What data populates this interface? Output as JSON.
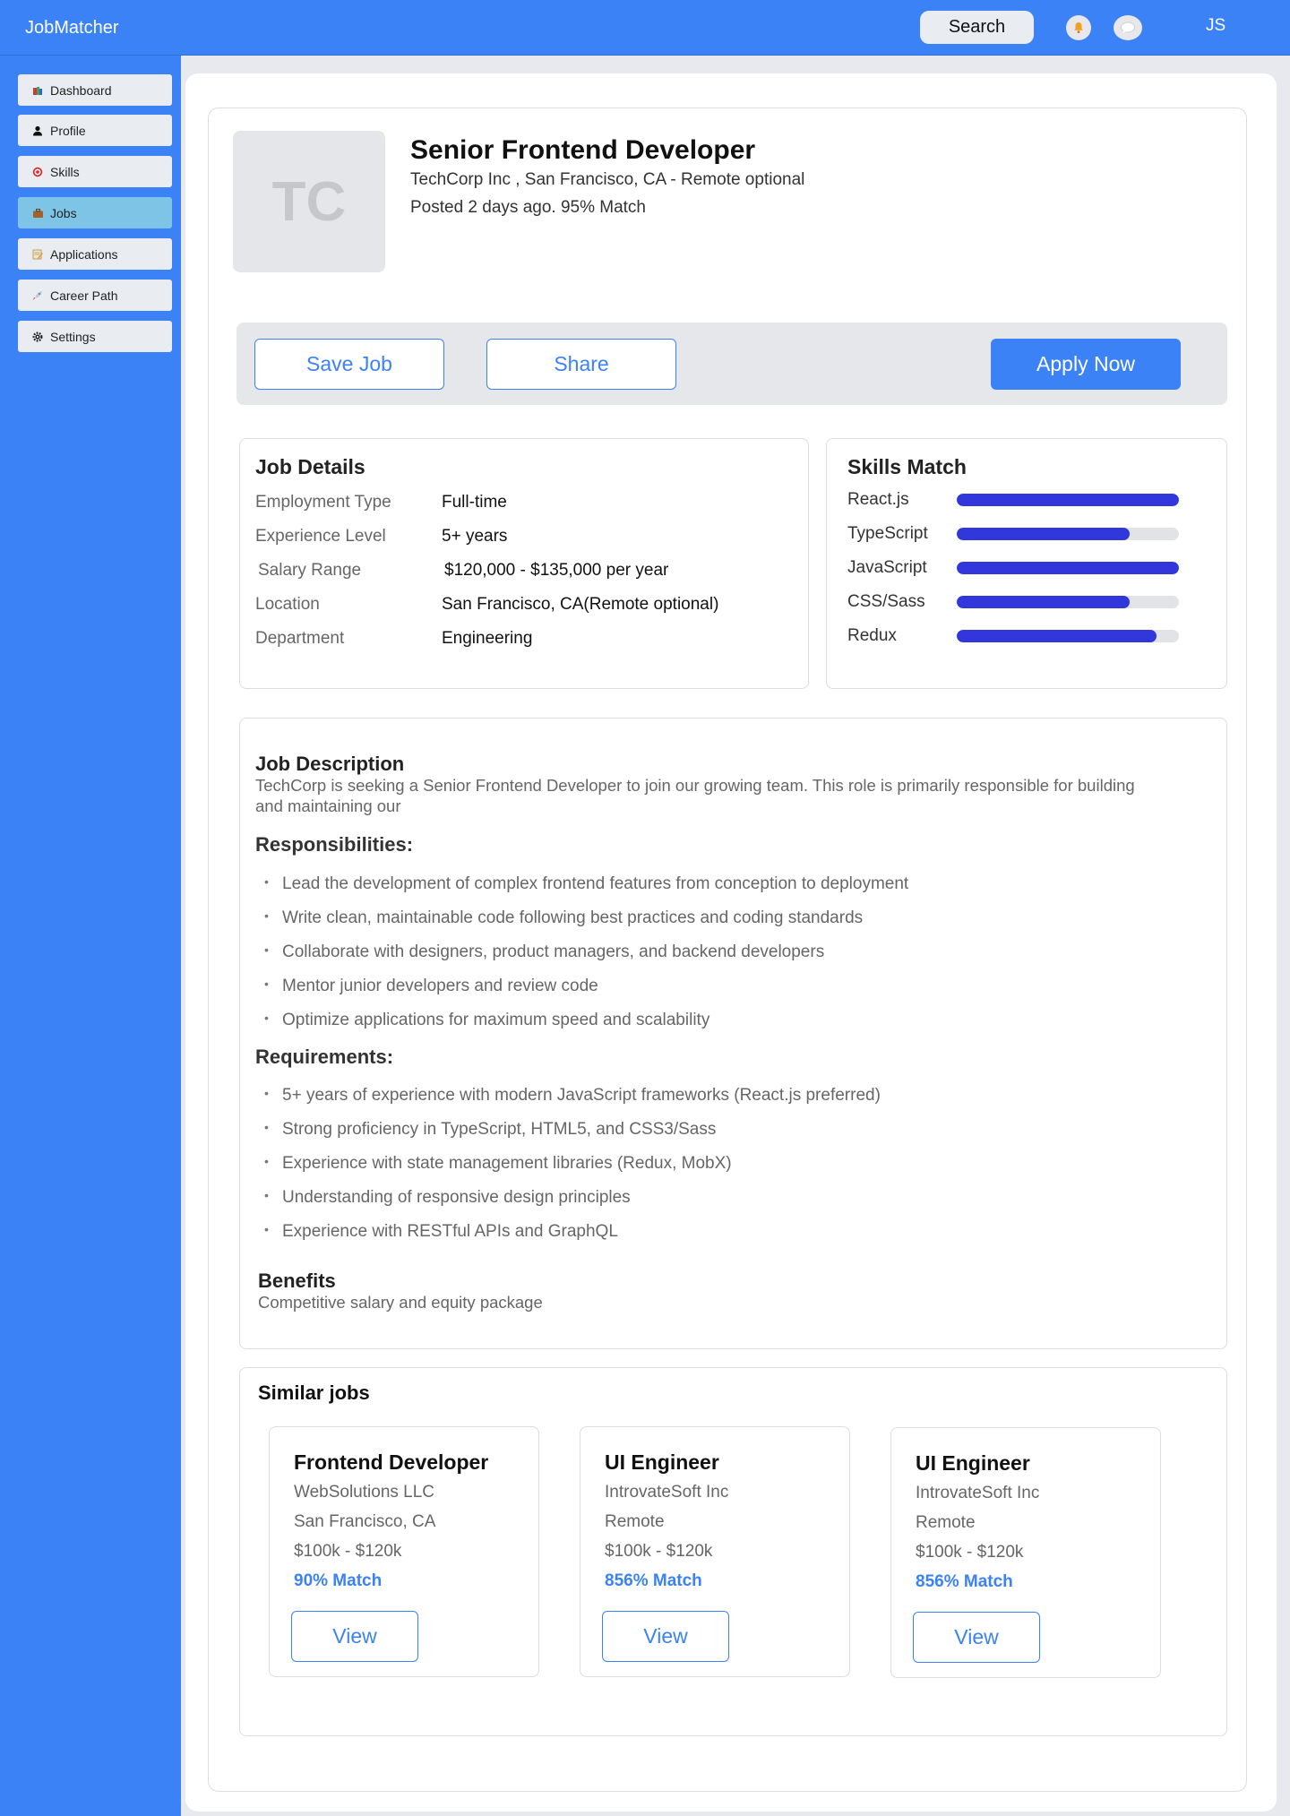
{
  "app": {
    "title": "JobMatcher",
    "avatar_initials": "JS"
  },
  "header": {
    "search_label": "Search",
    "bell_icon": "bell-icon",
    "chat_icon": "chat-icon"
  },
  "sidebar": {
    "items": [
      {
        "label": "Dashboard",
        "icon": "dashboard-icon"
      },
      {
        "label": "Profile",
        "icon": "user-icon"
      },
      {
        "label": "Skills",
        "icon": "target-icon"
      },
      {
        "label": "Jobs",
        "icon": "briefcase-icon",
        "active": true
      },
      {
        "label": "Applications",
        "icon": "memo-icon"
      },
      {
        "label": "Career Path",
        "icon": "rocket-icon"
      },
      {
        "label": "Settings",
        "icon": "gear-icon"
      }
    ]
  },
  "job": {
    "logo_initials": "TC",
    "title": "Senior Frontend Developer",
    "company_location": "TechCorp Inc , San Francisco, CA - Remote optional",
    "posted_match": "Posted 2 days ago. 95% Match"
  },
  "actions": {
    "save": "Save Job",
    "share": "Share",
    "apply": "Apply Now"
  },
  "details": {
    "title": "Job Details",
    "rows": [
      {
        "label": "Employment Type",
        "value": "Full-time"
      },
      {
        "label": "Experience Level",
        "value": "5+ years"
      },
      {
        "label": "Salary Range",
        "value": "$120,000 - $135,000 per year"
      },
      {
        "label": "Location",
        "value": "San Francisco, CA(Remote optional)"
      },
      {
        "label": "Department",
        "value": "Engineering"
      }
    ]
  },
  "skills": {
    "title": "Skills Match",
    "items": [
      {
        "name": "React.js",
        "level": 1.0
      },
      {
        "name": "TypeScript",
        "level": 0.78
      },
      {
        "name": "JavaScript",
        "level": 1.0
      },
      {
        "name": "CSS/Sass",
        "level": 0.78
      },
      {
        "name": "Redux",
        "level": 0.9
      }
    ]
  },
  "description": {
    "title": "Job Description",
    "text": "TechCorp is seeking a Senior Frontend Developer to join our growing team. This role is primarily responsible for building and maintaining our",
    "responsibilities_title": "Responsibilities:",
    "responsibilities": [
      "Lead the development of complex frontend features from conception to deployment",
      "Write clean, maintainable code following best practices and coding standards",
      "Collaborate with designers, product managers, and backend developers",
      "Mentor junior developers and review code",
      "Optimize applications for maximum speed and scalability"
    ],
    "requirements_title": "Requirements:",
    "requirements": [
      "5+ years of experience with modern JavaScript frameworks (React.js preferred)",
      "Strong proficiency in TypeScript, HTML5, and CSS3/Sass",
      "Experience with state management libraries (Redux, MobX)",
      "Understanding of responsive design principles",
      "Experience with RESTful APIs and GraphQL"
    ],
    "benefits_title": "Benefits",
    "benefits_text": "Competitive salary and equity package"
  },
  "similar": {
    "title": "Similar jobs",
    "jobs": [
      {
        "title": "Frontend Developer",
        "company": "WebSolutions LLC",
        "location": "San Francisco, CA",
        "salary": "$100k - $120k",
        "match": "90% Match",
        "view": "View"
      },
      {
        "title": "UI Engineer",
        "company": "IntrovateSoft Inc",
        "location": "Remote",
        "salary": "$100k - $120k",
        "match": "856% Match",
        "view": "View"
      },
      {
        "title": "UI Engineer",
        "company": "IntrovateSoft Inc",
        "location": "Remote",
        "salary": "$100k - $120k",
        "match": "856% Match",
        "view": "View"
      }
    ]
  },
  "colors": {
    "primary": "#3b82f6",
    "skill_bar": "#3237db",
    "active_nav": "#7ec4e6"
  }
}
